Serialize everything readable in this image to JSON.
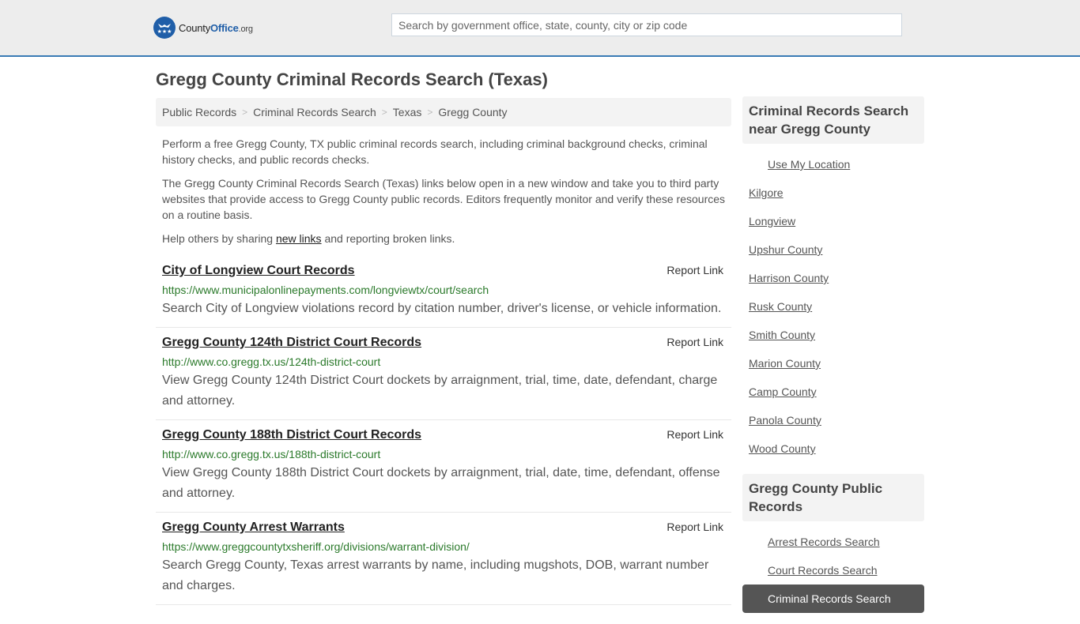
{
  "header": {
    "logo": {
      "county": "County",
      "office": "Office",
      "org": ".org",
      "icon": "eagle-stars-icon"
    },
    "search_placeholder": "Search by government office, state, county, city or zip code"
  },
  "page_title": "Gregg County Criminal Records Search (Texas)",
  "breadcrumb": [
    {
      "label": "Public Records"
    },
    {
      "label": "Criminal Records Search"
    },
    {
      "label": "Texas"
    },
    {
      "label": "Gregg County"
    }
  ],
  "breadcrumb_separator": ">",
  "intro": {
    "p1": "Perform a free Gregg County, TX public criminal records search, including criminal background checks, criminal history checks, and public records checks.",
    "p2": "The Gregg County Criminal Records Search (Texas) links below open in a new window and take you to third party websites that provide access to Gregg County public records. Editors frequently monitor and verify these resources on a routine basis.",
    "p3_before": "Help others by sharing ",
    "p3_link": "new links",
    "p3_after": " and reporting broken links."
  },
  "report_label": "Report Link",
  "listings": [
    {
      "title": "City of Longview Court Records",
      "url": "https://www.municipalonlinepayments.com/longviewtx/court/search",
      "description": "Search City of Longview violations record by citation number, driver's license, or vehicle information."
    },
    {
      "title": "Gregg County 124th District Court Records",
      "url": "http://www.co.gregg.tx.us/124th-district-court",
      "description": "View Gregg County 124th District Court dockets by arraignment, trial, time, date, defendant, charge and attorney."
    },
    {
      "title": "Gregg County 188th District Court Records",
      "url": "http://www.co.gregg.tx.us/188th-district-court",
      "description": "View Gregg County 188th District Court dockets by arraignment, trial, date, time, defendant, offense and attorney."
    },
    {
      "title": "Gregg County Arrest Warrants",
      "url": "https://www.greggcountytxsheriff.org/divisions/warrant-division/",
      "description": "Search Gregg County, Texas arrest warrants by name, including mugshots, DOB, warrant number and charges."
    }
  ],
  "sidebar": {
    "nearby": {
      "title": "Criminal Records Search near Gregg County",
      "use_location": "Use My Location",
      "items": [
        "Kilgore",
        "Longview",
        "Upshur County",
        "Harrison County",
        "Rusk County",
        "Smith County",
        "Marion County",
        "Camp County",
        "Panola County",
        "Wood County"
      ]
    },
    "public_records": {
      "title": "Gregg County Public Records",
      "items": [
        {
          "label": "Arrest Records Search",
          "active": false
        },
        {
          "label": "Court Records Search",
          "active": false
        },
        {
          "label": "Criminal Records Search",
          "active": true
        }
      ]
    }
  },
  "colors": {
    "header_bg": "#ededed",
    "header_border": "#3a7bb5",
    "brand_blue": "#1f5ea8",
    "url_green": "#2b7a2b",
    "active_bg": "#555555"
  }
}
